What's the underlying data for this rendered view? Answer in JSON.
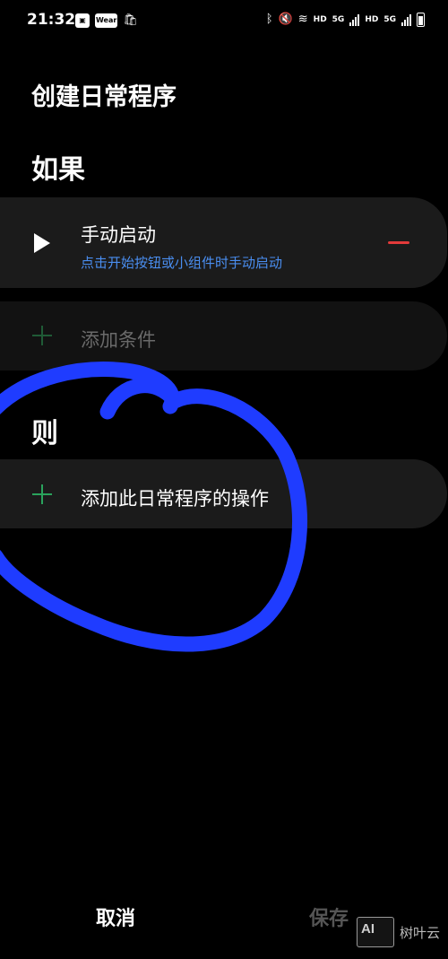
{
  "status_bar": {
    "time": "21:32",
    "left_icons": [
      "image-icon",
      "wear-icon",
      "shopping-bag-icon"
    ],
    "wear_label": "Wear",
    "right_icons": [
      "bluetooth-icon",
      "mute-icon",
      "wifi-icon",
      "signal-icon",
      "battery-icon"
    ],
    "hd1": "HD",
    "net1": "5G",
    "hd2": "HD",
    "net2": "5G"
  },
  "page": {
    "title": "创建日常程序"
  },
  "if_section": {
    "heading": "如果",
    "trigger": {
      "title": "手动启动",
      "description": "点击开始按钮或小组件时手动启动"
    },
    "add_condition_label": "添加条件"
  },
  "then_section": {
    "heading": "则",
    "add_action_label": "添加此日常程序的操作"
  },
  "footer": {
    "cancel_label": "取消",
    "save_label": "保存"
  },
  "watermark": {
    "logo_text": "AI",
    "text": "树叶云"
  },
  "colors": {
    "background": "#000000",
    "card": "#1b1b1b",
    "accent_blue": "#4a8ef0",
    "accent_green": "#2aa35c",
    "remove_red": "#e33a3a",
    "annotation_blue": "#1f3cff"
  }
}
